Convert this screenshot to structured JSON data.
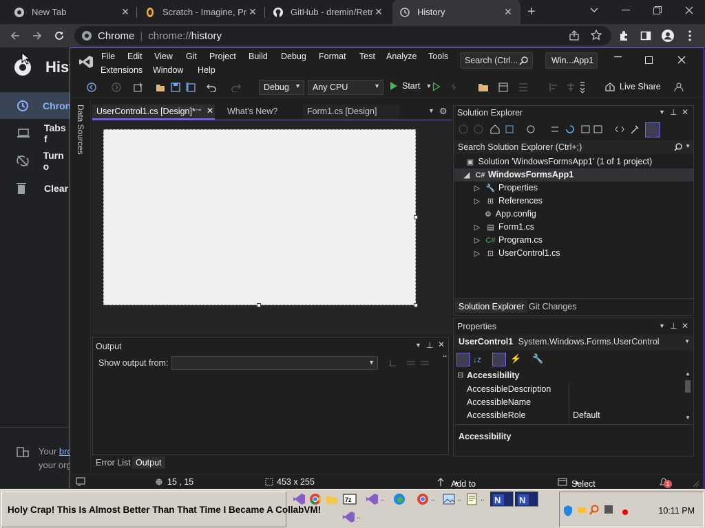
{
  "chrome": {
    "tabs": [
      {
        "title": "New Tab",
        "icon": "chrome-icon"
      },
      {
        "title": "Scratch - Imagine, Prog",
        "icon": "scratch-icon"
      },
      {
        "title": "GitHub - dremin/Retro",
        "icon": "github-icon"
      },
      {
        "title": "History",
        "icon": "history-icon"
      }
    ],
    "new_tab_symbol": "+",
    "omnibox": {
      "site": "Chrome",
      "separator": "|",
      "url_prefix": "chrome://",
      "url_path": "history"
    }
  },
  "history_page": {
    "title": "Hist",
    "nav": [
      {
        "label": "Chron",
        "icon": "clock-icon"
      },
      {
        "label": "Tabs f",
        "icon": "devices-icon"
      },
      {
        "label": "Turn o",
        "icon": "sync-off-icon"
      },
      {
        "label": "Clear",
        "icon": "trash-icon"
      }
    ],
    "managed_line1_text": "Your ",
    "managed_line1_link": "bro",
    "managed_line2": "your org"
  },
  "vs": {
    "menus_row1": [
      "File",
      "Edit",
      "View",
      "Git",
      "Project",
      "Build",
      "Debug",
      "Format",
      "Test",
      "Analyze",
      "Tools"
    ],
    "menus_row2": [
      "Extensions",
      "Window",
      "Help"
    ],
    "search_placeholder": "Search (Ctrl...",
    "solution_title": "Win...App1",
    "toolbar": {
      "config": "Debug",
      "platform": "Any CPU",
      "start_label": "Start",
      "live_share": "Live Share"
    },
    "data_sources_label": "Data Sources",
    "doc_tabs": [
      {
        "label": "UserControl1.cs [Design]*",
        "active": true
      },
      {
        "label": "What's New?",
        "active": false
      },
      {
        "label": "Form1.cs [Design]",
        "active": false
      }
    ],
    "output": {
      "title": "Output",
      "show_output_from": "Show output from:",
      "bottom_tabs": [
        "Error List",
        "Output"
      ]
    },
    "solution_explorer": {
      "title": "Solution Explorer",
      "search_placeholder": "Search Solution Explorer (Ctrl+;)",
      "solution_line": "Solution 'WindowsFormsApp1' (1 of 1 project)",
      "project": "WindowsFormsApp1",
      "items": [
        {
          "label": "Properties",
          "expandable": true
        },
        {
          "label": "References",
          "expandable": true
        },
        {
          "label": "App.config",
          "expandable": false
        },
        {
          "label": "Form1.cs",
          "expandable": true
        },
        {
          "label": "Program.cs",
          "expandable": true
        },
        {
          "label": "UserControl1.cs",
          "expandable": true
        }
      ],
      "bottom_tabs": [
        "Solution Explorer",
        "Git Changes"
      ]
    },
    "properties": {
      "title": "Properties",
      "object_name": "UserControl1",
      "object_type": "System.Windows.Forms.UserControl",
      "category": "Accessibility",
      "rows": [
        {
          "name": "AccessibleDescription",
          "value": ""
        },
        {
          "name": "AccessibleName",
          "value": ""
        },
        {
          "name": "AccessibleRole",
          "value": "Default"
        }
      ],
      "description_title": "Accessibility"
    },
    "status": {
      "position": "15 , 15",
      "size": "453 x 255",
      "source_control": "Add to Source Control",
      "repository": "Select Repository",
      "notifications": "1"
    }
  },
  "taskbar": {
    "start_text": "Holy Crap! This Is Almost Better Than That Time I Became A CollabVM!",
    "clock": "10:11 PM"
  },
  "colors": {
    "accent": "#7160e8",
    "vs_bg": "#1f1f1f",
    "chrome_bg": "#202124",
    "taskbar": "#d4d0c8"
  }
}
